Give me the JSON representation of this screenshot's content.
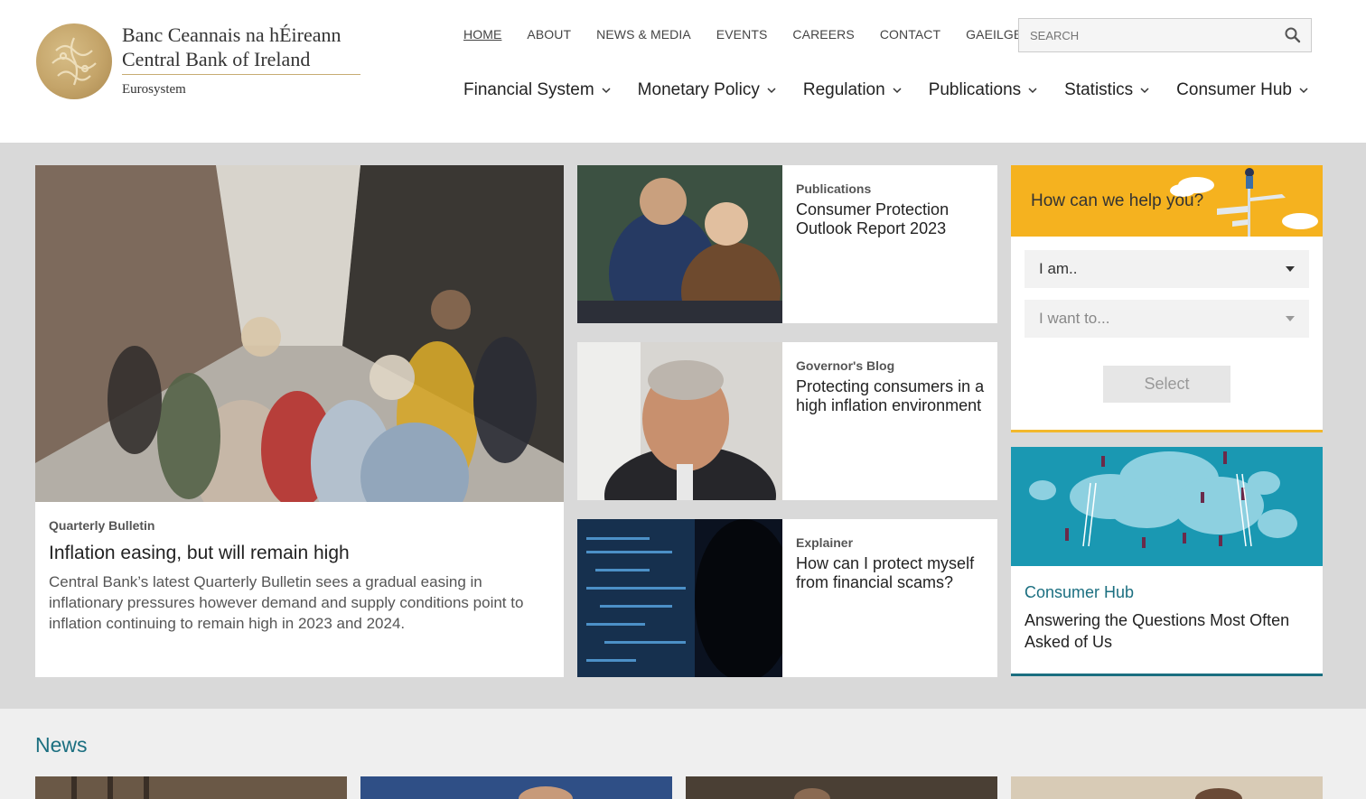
{
  "brand": {
    "line1": "Banc Ceannais na hÉireann",
    "line2": "Central Bank of Ireland",
    "line3": "Eurosystem",
    "seal_icon": "harp-seal-icon",
    "gold": "#c4a469"
  },
  "topnav": [
    {
      "label": "HOME",
      "active": true
    },
    {
      "label": "ABOUT"
    },
    {
      "label": "NEWS & MEDIA"
    },
    {
      "label": "EVENTS"
    },
    {
      "label": "CAREERS"
    },
    {
      "label": "CONTACT"
    },
    {
      "label": "GAEILGE"
    }
  ],
  "search": {
    "placeholder": "SEARCH",
    "value": "",
    "icon": "search-icon"
  },
  "mainnav": [
    {
      "label": "Financial System"
    },
    {
      "label": "Monetary Policy"
    },
    {
      "label": "Regulation"
    },
    {
      "label": "Publications"
    },
    {
      "label": "Statistics"
    },
    {
      "label": "Consumer Hub"
    }
  ],
  "feature": {
    "category": "Quarterly Bulletin",
    "title": "Inflation easing, but will remain high",
    "description": "Central Bank’s latest Quarterly Bulletin sees a gradual easing in inflationary pressures however demand and supply conditions point to inflation continuing to remain high in 2023 and 2024."
  },
  "cards": [
    {
      "category": "Publications",
      "title": "Consumer Protection Outlook Report 2023"
    },
    {
      "category": "Governor's Blog",
      "title": "Protecting consumers in a high inflation environment"
    },
    {
      "category": "Explainer",
      "title": "How can I protect myself from financial scams?"
    }
  ],
  "help": {
    "title": "How can we help you?",
    "select1": "I am..",
    "select2": "I want to...",
    "button": "Select",
    "accent": "#f5b21f"
  },
  "hub": {
    "category": "Consumer Hub",
    "title": "Answering the Questions Most Often Asked of Us",
    "accent": "#1b6f80"
  },
  "news": {
    "title": "News"
  }
}
